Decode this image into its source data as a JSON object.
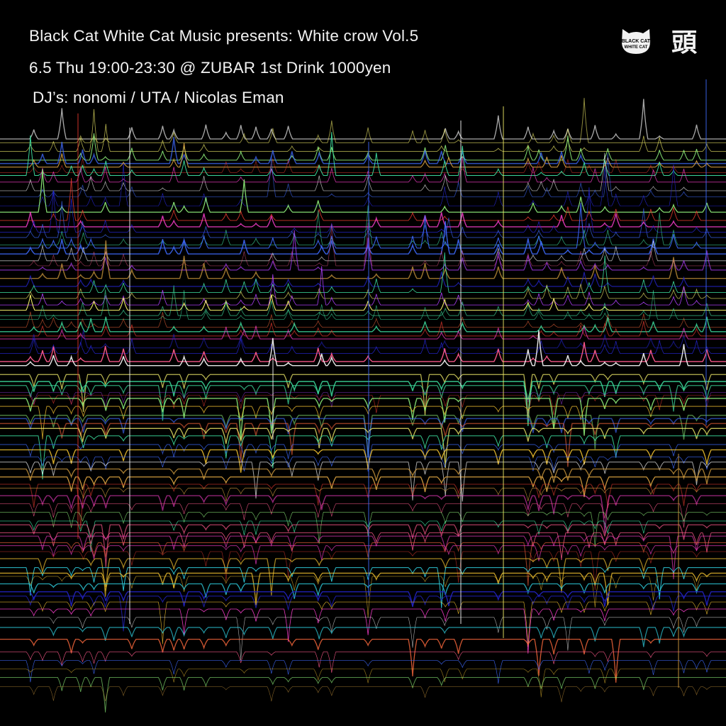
{
  "event": {
    "title_line": "Black Cat White Cat Music presents: White crow Vol.5",
    "date_line": "6.5 Thu 19:00-23:30 @ ZUBAR  1st Drink 1000yen",
    "djs_line": "DJ’s: nonomi / UTA / Nicolas Eman"
  },
  "logos": {
    "cat_logo_text_top": "BLACK CAT",
    "cat_logo_text_bottom": "WHITE CAT",
    "kanji_logo": "頭"
  },
  "colors": {
    "background": "#000000",
    "text": "#f2f2f2",
    "palette": [
      "#e63a2e",
      "#ff6a3d",
      "#ffcc33",
      "#f5f06a",
      "#8ff07a",
      "#3ee0a0",
      "#2fd0e0",
      "#3f6bff",
      "#2424c8",
      "#b040ff",
      "#ff3fd0",
      "#ff5a8c",
      "#ffffff",
      "#d8a040"
    ]
  }
}
